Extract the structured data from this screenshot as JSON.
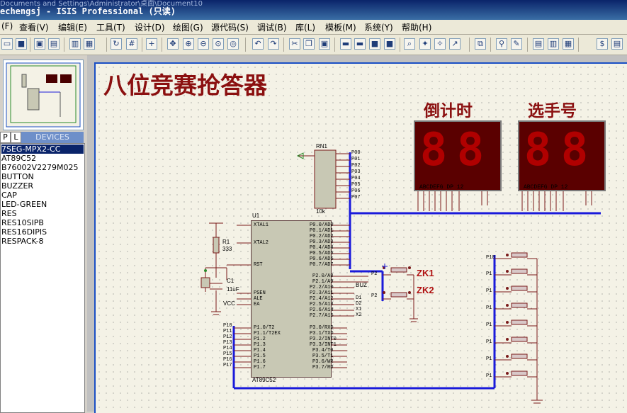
{
  "window": {
    "ghost_text": "Documents and Settings\\Administrator\\桌面\\Document10",
    "title": "echengsj - ISIS Professional (只读)"
  },
  "menu": [
    "(F)",
    "查看(V)",
    "编辑(E)",
    "工具(T)",
    "设计(D)",
    "绘图(G)",
    "源代码(S)",
    "调试(B)",
    "库(L)",
    "模板(M)",
    "系统(Y)",
    "帮助(H)"
  ],
  "tabs": {
    "p": "P",
    "l": "L",
    "devices": "DEVICES"
  },
  "devices": [
    "7SEG-MPX2-CC",
    "AT89C52",
    "B76002V2279M025",
    "BUTTON",
    "BUZZER",
    "CAP",
    "LED-GREEN",
    "RES",
    "RES10SIPB",
    "RES16DIPIS",
    "RESPACK-8"
  ],
  "selected_device": "7SEG-MPX2-CC",
  "schematic": {
    "title": "八位竞赛抢答器",
    "countdown_label": "倒计时",
    "player_label": "选手号",
    "display_pins": "ABCDEFG DP    12",
    "zk1": "ZK1",
    "zk2": "ZK2",
    "u1": "U1",
    "u1_part": "AT89C52",
    "rn1": "RN1",
    "rn1_value": "10k",
    "r1": "R1",
    "r1_value": "333",
    "c1": "C1",
    "c1_value": "11uF",
    "vcc": "VCC",
    "buz": "BUZ",
    "left_pins": [
      "XTAL1",
      "XTAL2",
      "RST",
      "PSEN",
      "ALE",
      "EA",
      "P1.0/T2",
      "P1.1/T2EX",
      "P1.2",
      "P1.3",
      "P1.4",
      "P1.5",
      "P1.6",
      "P1.7"
    ],
    "right_pins": [
      "P0.0/AD0",
      "P0.1/AD1",
      "P0.2/AD2",
      "P0.3/AD3",
      "P0.4/AD4",
      "P0.5/AD5",
      "P0.6/AD6",
      "P0.7/AD7",
      "P2.0/A8",
      "P2.1/A9",
      "P2.2/A10",
      "P2.3/A11",
      "P2.4/A12",
      "P2.5/A13",
      "P2.6/A14",
      "P2.7/A15",
      "P3.0/RXD",
      "P3.1/TXD",
      "P3.2/INT0",
      "P3.3/INT1",
      "P3.4/T0",
      "P3.5/T1",
      "P3.6/WR",
      "P3.7/RD"
    ],
    "p1_labels": [
      "P10",
      "P11",
      "P12",
      "P13",
      "P14",
      "P15",
      "P16",
      "P17"
    ],
    "p0_labels": [
      "P00",
      "P01",
      "P02",
      "P03",
      "P04",
      "P05",
      "P06",
      "P07"
    ],
    "p2_side": [
      "P2",
      "P2",
      "BUZ",
      "D1",
      "D2",
      "X1",
      "X2"
    ],
    "switch_labels": [
      "P10",
      "P1",
      "P1",
      "P1",
      "P1",
      "P1",
      "P1",
      "P1"
    ]
  }
}
